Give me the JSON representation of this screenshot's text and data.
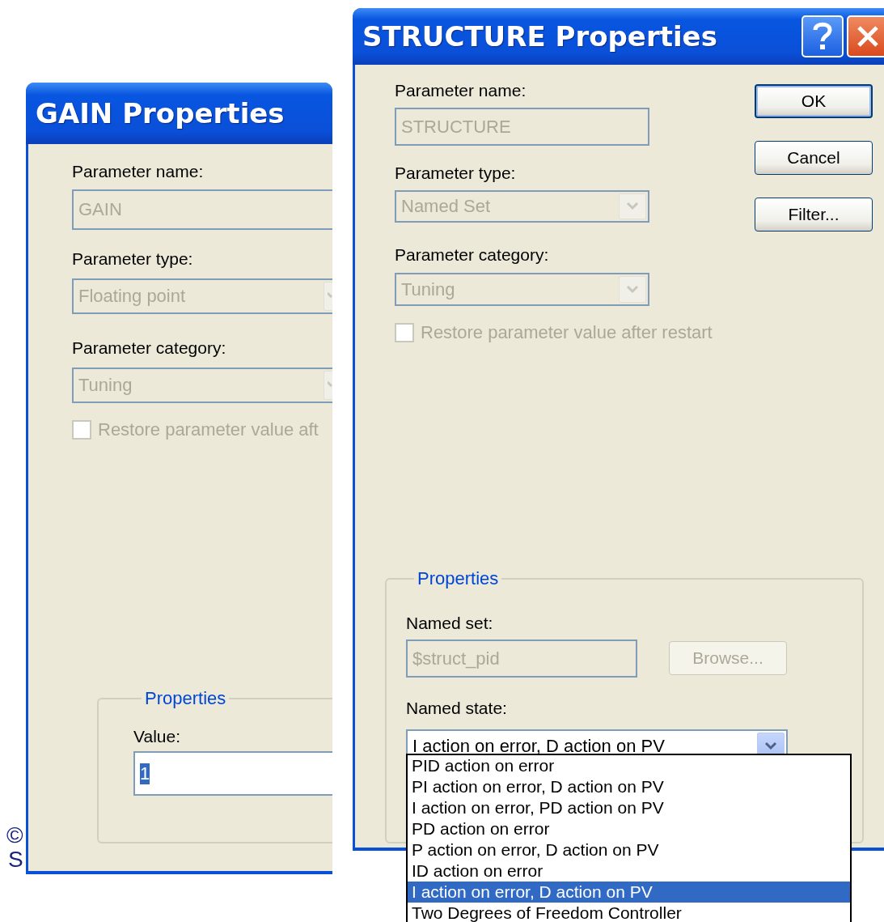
{
  "background_text": [
    "©",
    "S"
  ],
  "gain_dialog": {
    "title": "GAIN Properties",
    "fields": [
      {
        "kind": "text",
        "label": "Parameter name:",
        "value": "GAIN",
        "disabled": true
      },
      {
        "kind": "combo",
        "label": "Parameter type:",
        "value": "Floating point",
        "disabled": true
      },
      {
        "kind": "combo",
        "label": "Parameter category:",
        "value": "Tuning",
        "disabled": true
      }
    ],
    "restore_checkbox": {
      "label": "Restore parameter value aft",
      "checked": false,
      "disabled": true
    },
    "properties": {
      "legend": "Properties",
      "value_label": "Value:",
      "value": "1",
      "value_selected": true
    }
  },
  "structure_dialog": {
    "title": "STRUCTURE Properties",
    "fields": [
      {
        "kind": "text",
        "label": "Parameter name:",
        "value": "STRUCTURE",
        "disabled": true
      },
      {
        "kind": "combo",
        "label": "Parameter type:",
        "value": "Named Set",
        "disabled": true
      },
      {
        "kind": "combo",
        "label": "Parameter category:",
        "value": "Tuning",
        "disabled": true
      }
    ],
    "restore_checkbox": {
      "label": "Restore parameter value after restart",
      "checked": false,
      "disabled": true
    },
    "buttons": [
      {
        "label": "OK",
        "default": true
      },
      {
        "label": "Cancel",
        "default": false
      },
      {
        "label": "Filter...",
        "default": false
      }
    ],
    "properties": {
      "legend": "Properties",
      "named_set_label": "Named set:",
      "named_set_value": "$struct_pid",
      "named_set_disabled": true,
      "browse_button": {
        "label": "Browse...",
        "disabled": true
      },
      "named_state_label": "Named state:",
      "named_state_value": "I action on error, D action on PV",
      "dropdown_options": [
        {
          "label": "PID action on error",
          "selected": false
        },
        {
          "label": "PI action on error, D action on PV",
          "selected": false
        },
        {
          "label": "I action on error, PD action on PV",
          "selected": false
        },
        {
          "label": "PD action on error",
          "selected": false
        },
        {
          "label": "P action on error, D action on PV",
          "selected": false
        },
        {
          "label": "ID action on error",
          "selected": false
        },
        {
          "label": "I action on error, D action on PV",
          "selected": true
        },
        {
          "label": "Two Degrees of Freedom Controller",
          "selected": false
        }
      ]
    }
  }
}
